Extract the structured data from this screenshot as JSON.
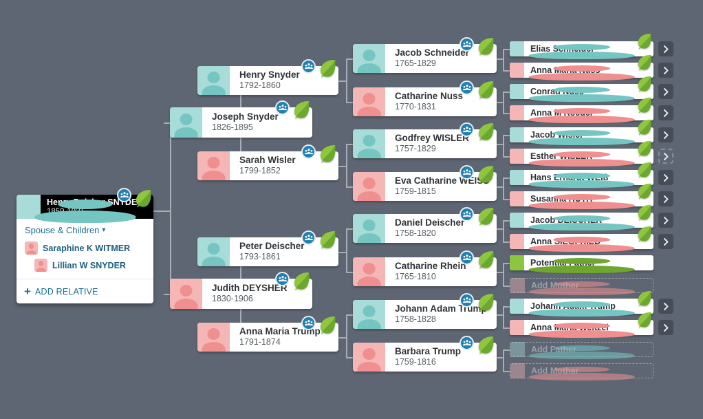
{
  "app": {
    "view_name": "family-tree-pedigree-view",
    "background_color": "#5f6673",
    "accent_color": "#1a6f90",
    "male_color": "#a8dcd9",
    "female_color": "#f5b6b6",
    "potential_color": "#8cc63e"
  },
  "focal_person": {
    "name": "Henry Deisher SNYDER",
    "dates": "1859-1931",
    "gender": "male",
    "badge_icon": "family-group-icon",
    "leaf_icon": "leaf-hint-icon",
    "spouse_children_label": "Spouse & Children",
    "spouse_children_chevron": "▾",
    "relatives": [
      {
        "name": "Saraphine K WITMER",
        "gender": "female",
        "indent": 0
      },
      {
        "name": "Lillian W SNYDER",
        "gender": "female",
        "indent": 1
      }
    ],
    "add_relative_label": "ADD RELATIVE",
    "add_relative_icon": "plus-icon"
  },
  "generation_2": [
    {
      "name": "Henry Snyder",
      "dates": "1792-1860",
      "gender": "male",
      "badge": true,
      "leaf": true
    },
    {
      "name": "Joseph Snyder",
      "dates": "1826-1895",
      "gender": "male",
      "badge": true,
      "leaf": true,
      "focused_parent": true
    },
    {
      "name": "Sarah Wisler",
      "dates": "1799-1852",
      "gender": "female",
      "badge": true,
      "leaf": true
    },
    {
      "name": "Peter Deischer",
      "dates": "1793-1861",
      "gender": "male",
      "badge": true,
      "leaf": true
    },
    {
      "name": "Judith DEYSHER",
      "dates": "1830-1906",
      "gender": "female",
      "badge": true,
      "leaf": true,
      "focused_parent": true
    },
    {
      "name": "Anna Maria Trump",
      "dates": "1791-1874",
      "gender": "female",
      "badge": true,
      "leaf": true
    }
  ],
  "generation_3": [
    {
      "name": "Jacob Schneider",
      "dates": "1765-1829",
      "gender": "male",
      "badge": true,
      "leaf": true
    },
    {
      "name": "Catharine Nuss",
      "dates": "1770-1831",
      "gender": "female",
      "badge": true,
      "leaf": true
    },
    {
      "name": "Godfrey WISLER",
      "dates": "1757-1829",
      "gender": "male",
      "badge": true,
      "leaf": true
    },
    {
      "name": "Eva Catharine WEISS",
      "dates": "1759-1815",
      "gender": "female",
      "badge": true,
      "leaf": true
    },
    {
      "name": "Daniel Deischer",
      "dates": "1758-1820",
      "gender": "male",
      "badge": true,
      "leaf": true
    },
    {
      "name": "Catharine Rhein",
      "dates": "1765-1810",
      "gender": "female",
      "badge": true,
      "leaf": true
    },
    {
      "name": "Johann Adam Trump",
      "dates": "1758-1828",
      "gender": "male",
      "badge": true,
      "leaf": true
    },
    {
      "name": "Barbara Trump",
      "dates": "1759-1816",
      "gender": "female",
      "badge": true,
      "leaf": true
    }
  ],
  "generation_4": [
    {
      "name": "Elias Schneider",
      "gender": "male",
      "leaf": true,
      "chevron": "solid"
    },
    {
      "name": "Anna Maria Nuss",
      "gender": "female",
      "leaf": true,
      "chevron": "solid"
    },
    {
      "name": "Conrad Nuss",
      "gender": "male",
      "leaf": true,
      "chevron": "solid"
    },
    {
      "name": "Anna M Roeder",
      "gender": "female",
      "leaf": true,
      "chevron": "solid"
    },
    {
      "name": "Jacob Wisler",
      "gender": "male",
      "leaf": true,
      "chevron": "solid"
    },
    {
      "name": "Esther WIßLER",
      "gender": "female",
      "leaf": true,
      "chevron": "dashed"
    },
    {
      "name": "Hans Erhardt WEIß",
      "gender": "male",
      "leaf": true,
      "chevron": "solid"
    },
    {
      "name": "Susanna HUTH",
      "gender": "female",
      "leaf": true,
      "chevron": "solid"
    },
    {
      "name": "Jacob DEISCHER",
      "gender": "male",
      "leaf": true,
      "chevron": "solid"
    },
    {
      "name": "Anna SIEGFRIED",
      "gender": "female",
      "leaf": true,
      "chevron": "solid"
    },
    {
      "name": "Potential Father",
      "gender": "potential",
      "leaf": false,
      "chevron": "none"
    },
    {
      "name": "Add Mother",
      "gender": "female",
      "leaf": false,
      "chevron": "none",
      "placeholder": true
    },
    {
      "name": "Johann Adam Trump",
      "gender": "male",
      "leaf": true,
      "chevron": "solid"
    },
    {
      "name": "Anna Maria Weitzel",
      "gender": "female",
      "leaf": true,
      "chevron": "solid"
    },
    {
      "name": "Add Father",
      "gender": "male",
      "leaf": false,
      "chevron": "none",
      "placeholder": true
    },
    {
      "name": "Add Mother",
      "gender": "female",
      "leaf": false,
      "chevron": "none",
      "placeholder": true
    }
  ]
}
